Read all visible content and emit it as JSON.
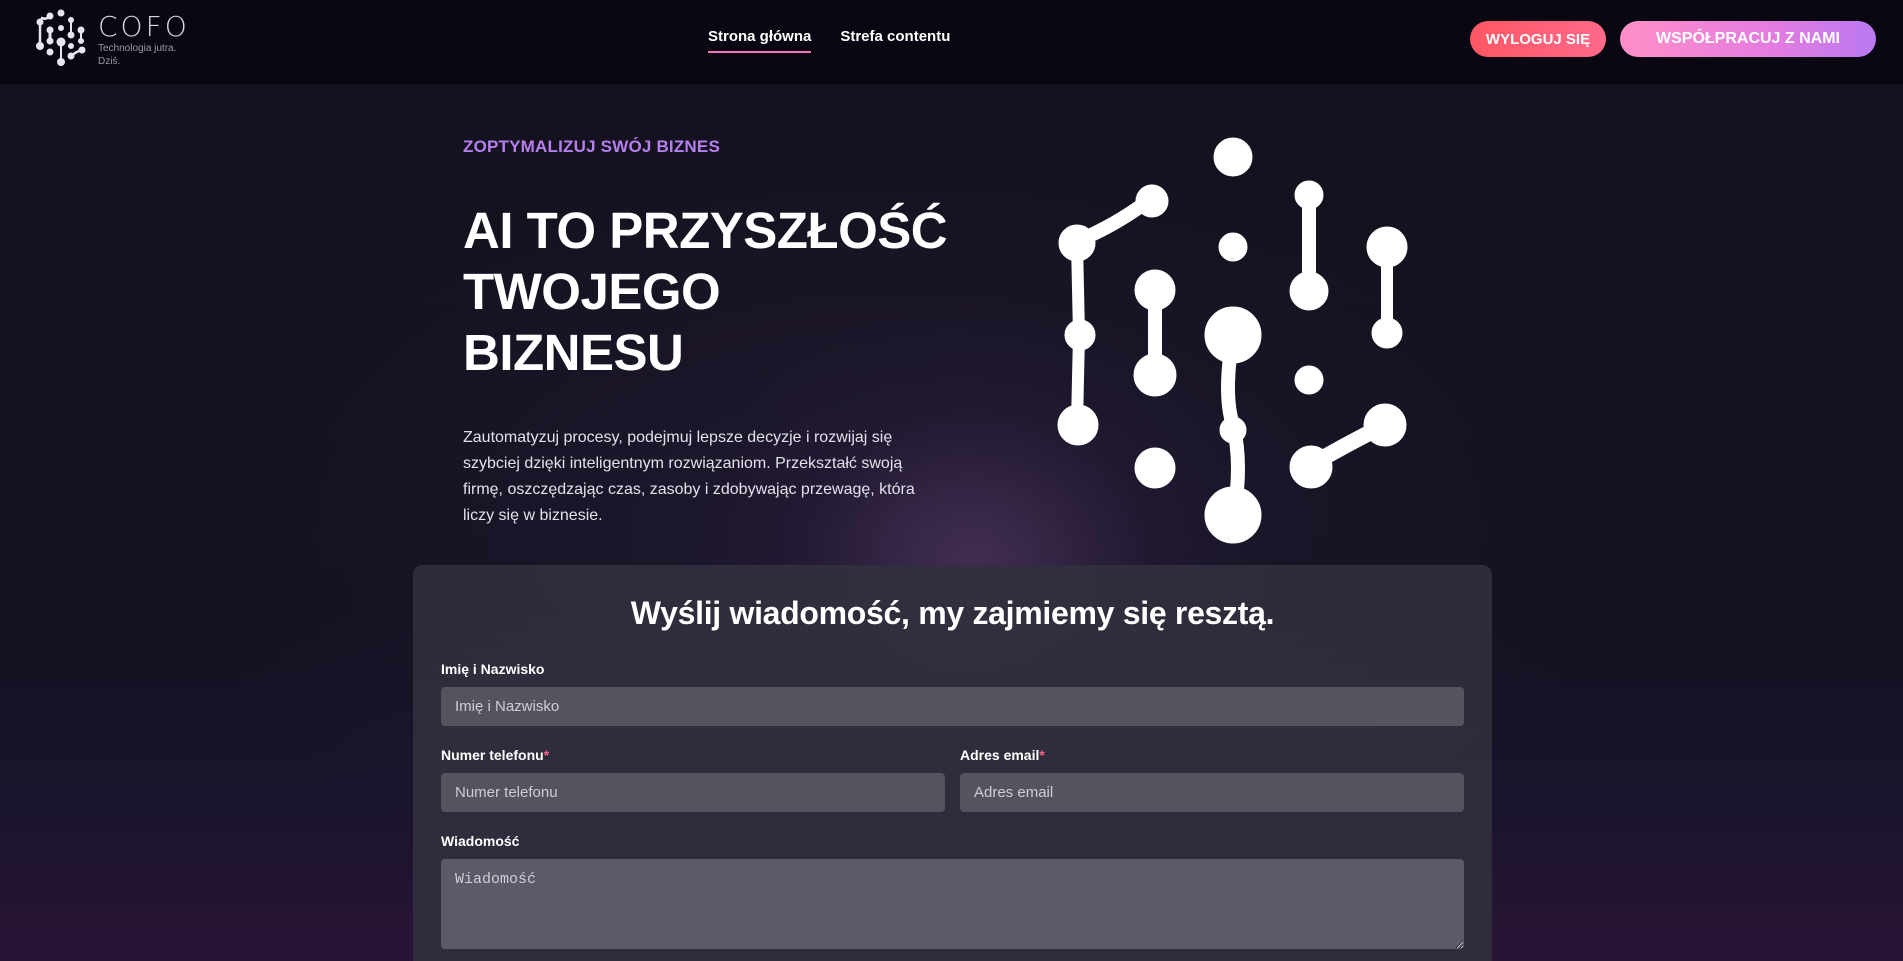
{
  "header": {
    "logo_name": "COFO",
    "logo_tagline_1": "Technologia jutra.",
    "logo_tagline_2": "Dziś.",
    "nav": [
      {
        "label": "Strona główna",
        "active": true
      },
      {
        "label": "Strefa contentu",
        "active": false
      }
    ],
    "logout_label": "WYLOGUJ SIĘ",
    "cooperate_label": "WSPÓŁPRACUJ Z NAMI"
  },
  "hero": {
    "eyebrow": "ZOPTYMALIZUJ SWÓJ BIZNES",
    "title_line_1": "AI TO PRZYSZŁOŚĆ",
    "title_line_2": "TWOJEGO",
    "title_line_3": "BIZNESU",
    "description": "Zautomatyzuj procesy, podejmuj lepsze decyzje i rozwijaj się szybciej dzięki inteligentnym rozwiązaniom. Przekształć swoją firmę, oszczędzając czas, zasoby i zdobywając przewagę, która liczy się w biznesie."
  },
  "form": {
    "title": "Wyślij wiadomość, my zajmiemy się resztą.",
    "name_label": "Imię i Nazwisko",
    "name_placeholder": "Imię i Nazwisko",
    "phone_label": "Numer telefonu",
    "phone_placeholder": "Numer telefonu",
    "email_label": "Adres email",
    "email_placeholder": "Adres email",
    "required_mark": "*",
    "message_label": "Wiadomość",
    "message_placeholder": "Wiadomość"
  },
  "colors": {
    "accent_purple": "#b67ff0",
    "accent_pink": "#ff6fb5",
    "logout_red": "#ff5663",
    "background": "#0d0b17"
  },
  "icons": {
    "logo": "molecule-network-icon",
    "hero": "molecule-network-icon"
  }
}
